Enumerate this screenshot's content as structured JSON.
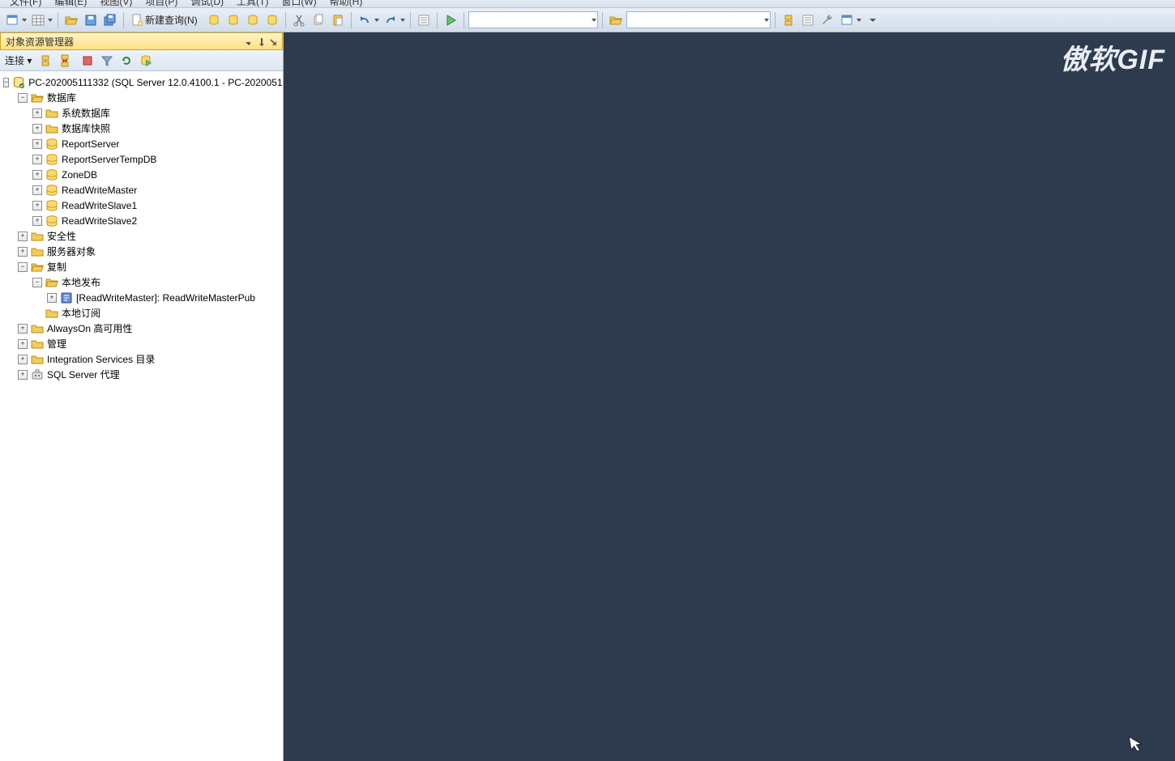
{
  "menu": {
    "items": [
      "文件(F)",
      "编辑(E)",
      "视图(V)",
      "项目(P)",
      "调试(D)",
      "工具(T)",
      "窗口(W)",
      "帮助(H)"
    ]
  },
  "toolbar": {
    "new_query": "新建查询(N)"
  },
  "sidebar": {
    "title": "对象资源管理器",
    "connect_label": "连接 ▾"
  },
  "tree": {
    "root": "PC-202005111332 (SQL Server 12.0.4100.1 - PC-2020051",
    "databases": "数据库",
    "sysdb": "系统数据库",
    "dbsnap": "数据库快照",
    "db1": "ReportServer",
    "db2": "ReportServerTempDB",
    "db3": "ZoneDB",
    "db4": "ReadWriteMaster",
    "db5": "ReadWriteSlave1",
    "db6": "ReadWriteSlave2",
    "security": "安全性",
    "serverobjects": "服务器对象",
    "replication": "复制",
    "localpub": "本地发布",
    "pub1": "[ReadWriteMaster]: ReadWriteMasterPub",
    "localsub": "本地订阅",
    "alwayson": "AlwaysOn 高可用性",
    "management": "管理",
    "isc": "Integration Services 目录",
    "agent": "SQL Server 代理"
  },
  "watermark": "傲软GIF"
}
